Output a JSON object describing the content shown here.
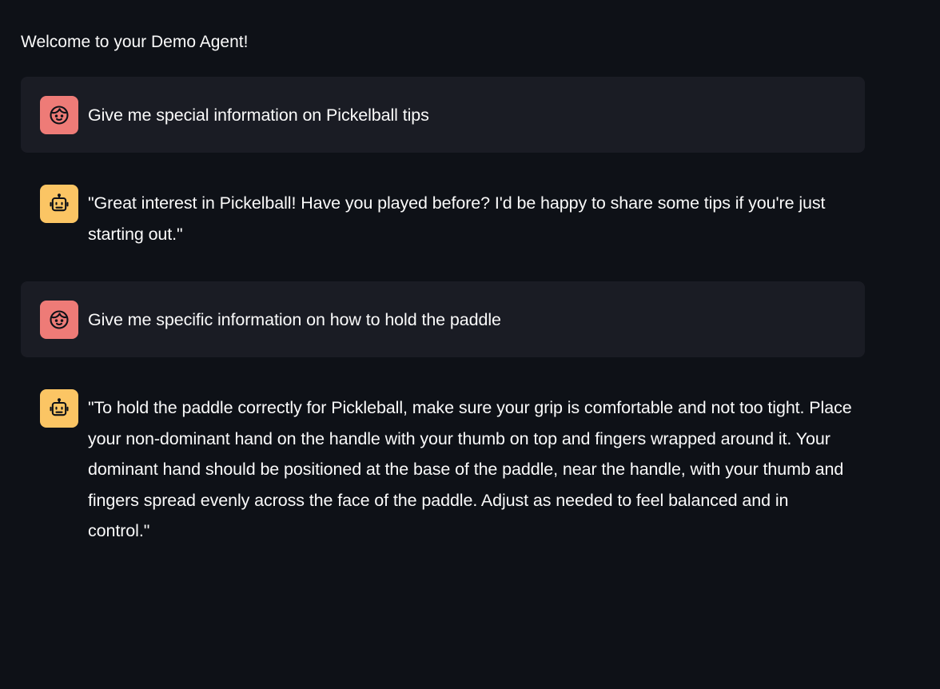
{
  "page": {
    "welcome_text": "Welcome to your Demo Agent!"
  },
  "messages": [
    {
      "role": "user",
      "avatar_icon": "user-face-icon",
      "text": "Give me special information on Pickelball tips"
    },
    {
      "role": "assistant",
      "avatar_icon": "robot-icon",
      "text": "\"Great interest in Pickelball! Have you played before? I'd be happy to share some tips if you're just starting out.\""
    },
    {
      "role": "user",
      "avatar_icon": "user-face-icon",
      "text": "Give me specific information on how to hold the paddle"
    },
    {
      "role": "assistant",
      "avatar_icon": "robot-icon",
      "text": "\"To hold the paddle correctly for Pickleball, make sure your grip is comfortable and not too tight. Place your non-dominant hand on the handle with your thumb on top and fingers wrapped around it. Your dominant hand should be positioned at the base of the paddle, near the handle, with your thumb and fingers spread evenly across the face of the paddle. Adjust as needed to feel balanced and in control.\""
    }
  ],
  "colors": {
    "background": "#0e1117",
    "user_bubble": "#1a1c24",
    "user_avatar": "#ee7b77",
    "assistant_avatar": "#fbc564",
    "text": "#fafafa"
  }
}
